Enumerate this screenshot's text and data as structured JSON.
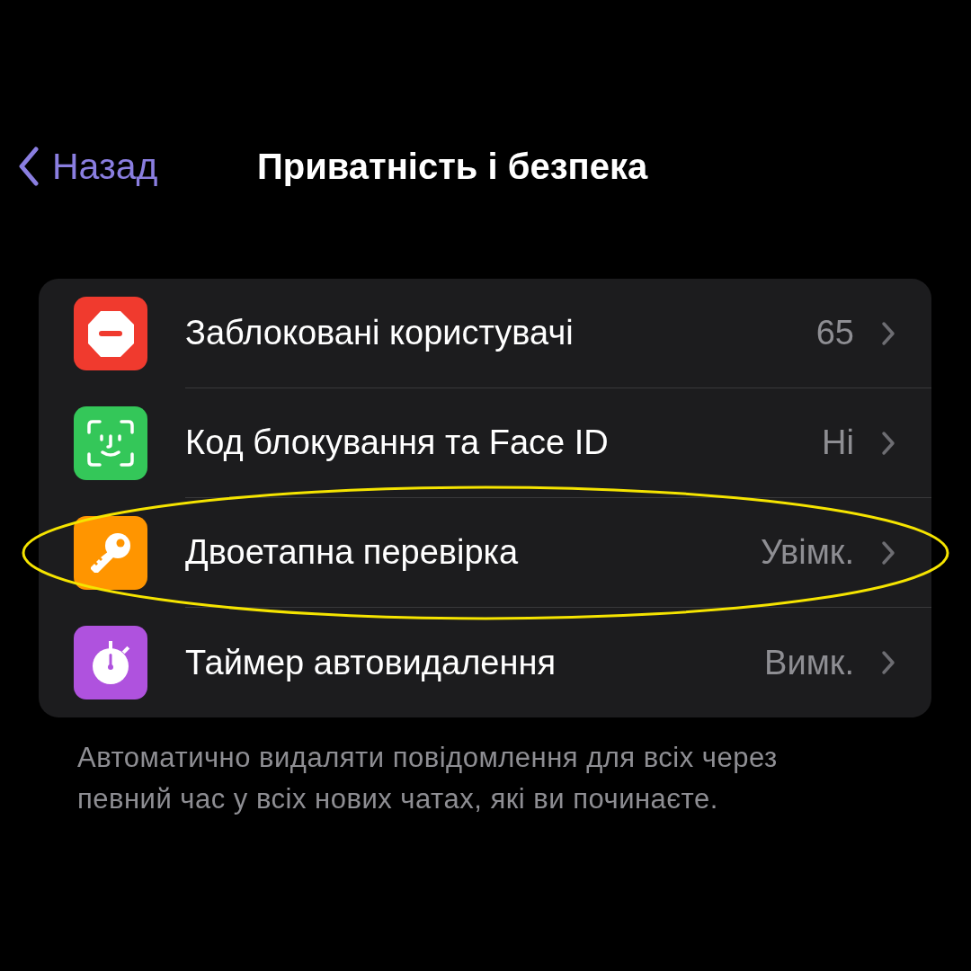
{
  "nav": {
    "back": "Назад",
    "title": "Приватність і безпека"
  },
  "rows": [
    {
      "kind": "blocked",
      "color": "#f03a2e",
      "label": "Заблоковані користувачі",
      "value": "65",
      "highlighted": false
    },
    {
      "kind": "faceid",
      "color": "#34c759",
      "label": "Код блокування та Face ID",
      "value": "Ні",
      "highlighted": false
    },
    {
      "kind": "key",
      "color": "#ff9500",
      "label": "Двоетапна перевірка",
      "value": "Увімк.",
      "highlighted": true
    },
    {
      "kind": "timer",
      "color": "#af52de",
      "label": "Таймер автовидалення",
      "value": "Вимк.",
      "highlighted": false
    }
  ],
  "footer": "Автоматично видаляти повідомлення для всіх через певний час у всіх нових чатах, які ви починаєте."
}
